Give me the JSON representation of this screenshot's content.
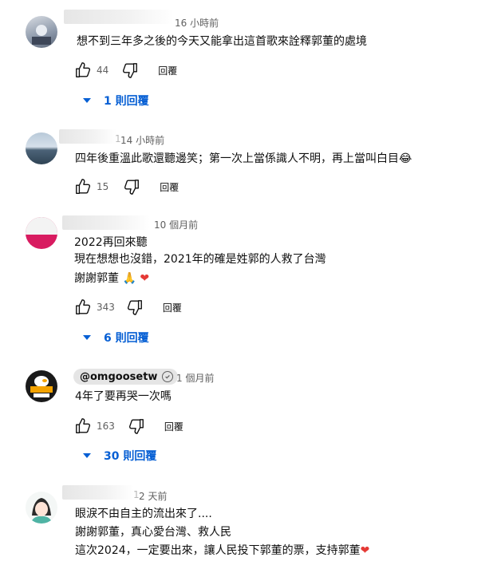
{
  "comments": [
    {
      "time": "16 小時前",
      "lines": [
        "想不到三年多之後的今天又能拿出這首歌來詮釋郭董的處境"
      ],
      "likes": "44",
      "reply_label": "回覆",
      "replies_label": "1 則回覆"
    },
    {
      "time_prefix": "1",
      "time": "14 小時前",
      "lines": [
        "四年後重溫此歌還聽邊笑；第一次上當係識人不明，再上當叫白目"
      ],
      "emoji": "😂",
      "likes": "15",
      "reply_label": "回覆"
    },
    {
      "time": "10 個月前",
      "lines": [
        "2022再回來聽",
        "現在想想也沒錯，2021年的確是姓郭的人救了台灣",
        "謝謝郭董"
      ],
      "emoji_pray": "🙏",
      "emoji_heart": "❤",
      "likes": "343",
      "reply_label": "回覆",
      "replies_label": "6 則回覆"
    },
    {
      "handle": "@omgoosetw",
      "avatar_text": "走火鵝 娛樂",
      "time": "1 個月前",
      "lines": [
        "4年了要再哭一次嗎"
      ],
      "likes": "163",
      "reply_label": "回覆",
      "replies_label": "30 則回覆"
    },
    {
      "time_prefix": "1",
      "time": "2 天前",
      "lines": [
        "眼淚不由自主的流出來了....",
        "謝謝郭董，真心愛台灣、救人民",
        "這次2024，一定要出來，讓人民投下郭董的票，支持郭董"
      ],
      "emoji_heart": "❤"
    }
  ],
  "colors": {
    "link": "#065fd4",
    "meta": "#606060",
    "text": "#0f0f0f",
    "heart": "#e53935"
  }
}
